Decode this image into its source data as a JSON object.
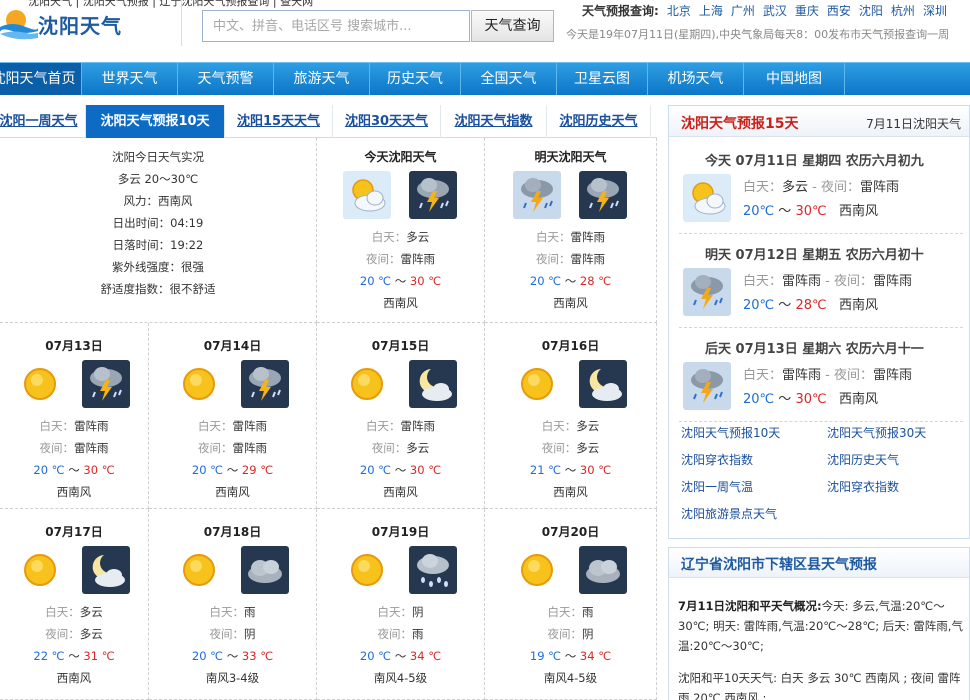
{
  "header": {
    "top_links": "沈阳天气 | 沈阳天气预报 | 辽宁沈阳天气预报查询 | 查天网",
    "logo_text": "沈阳天气",
    "search_placeholder": "中文、拼音、电话区号 搜索城市...",
    "search_button": "天气查询",
    "quick_label": "天气预报查询:",
    "quick_cities": [
      "北京",
      "上海",
      "广州",
      "武汉",
      "重庆",
      "西安",
      "沈阳",
      "杭州",
      "深圳"
    ],
    "publish_info": "今天是19年07月11日(星期四),中央气象局每天8：00发布市天气预报查询一周"
  },
  "nav": [
    "沈阳天气首页",
    "世界天气",
    "天气预警",
    "旅游天气",
    "历史天气",
    "全国天气",
    "卫星云图",
    "机场天气",
    "中国地图"
  ],
  "tabs": [
    "沈阳一周天气",
    "沈阳天气预报10天",
    "沈阳15天天气",
    "沈阳30天天气",
    "沈阳天气指数",
    "沈阳历史天气"
  ],
  "today_info": {
    "title": "沈阳今日天气实况",
    "weather": "多云 20～30℃",
    "wind": "风力：西南风",
    "sunrise": "日出时间：04:19",
    "sunset": "日落时间：19:22",
    "uv": "紫外线强度：很强",
    "comfort": "舒适度指数：很不舒适"
  },
  "labels": {
    "day": "白天：",
    "night": "夜间：",
    "sep": "～"
  },
  "forecast": [
    {
      "title": "今天沈阳天气",
      "day_icon": "partly-cloudy-day-icon",
      "night_icon": "thunder-rain-night-icon",
      "day": "多云",
      "night": "雷阵雨",
      "low": "20 ℃",
      "high": "30 ℃",
      "wind": "西南风"
    },
    {
      "title": "明天沈阳天气",
      "day_icon": "thunder-rain-day-icon",
      "night_icon": "thunder-rain-night-icon",
      "day": "雷阵雨",
      "night": "雷阵雨",
      "low": "20 ℃",
      "high": "28 ℃",
      "wind": "西南风"
    },
    {
      "title": "07月13日",
      "day_icon": "sunny-icon",
      "night_icon": "thunder-rain-night-icon",
      "day": "雷阵雨",
      "night": "雷阵雨",
      "low": "20 ℃",
      "high": "30 ℃",
      "wind": "西南风"
    },
    {
      "title": "07月14日",
      "day_icon": "sunny-icon",
      "night_icon": "thunder-rain-night-icon",
      "day": "雷阵雨",
      "night": "雷阵雨",
      "low": "20 ℃",
      "high": "29 ℃",
      "wind": "西南风"
    },
    {
      "title": "07月15日",
      "day_icon": "sunny-icon",
      "night_icon": "moon-cloud-icon",
      "day": "雷阵雨",
      "night": "多云",
      "low": "20 ℃",
      "high": "30 ℃",
      "wind": "西南风"
    },
    {
      "title": "07月16日",
      "day_icon": "sunny-icon",
      "night_icon": "moon-cloud-icon",
      "day": "多云",
      "night": "多云",
      "low": "21 ℃",
      "high": "30 ℃",
      "wind": "西南风"
    },
    {
      "title": "07月17日",
      "day_icon": "sunny-icon",
      "night_icon": "moon-cloud-icon",
      "day": "多云",
      "night": "多云",
      "low": "22 ℃",
      "high": "31 ℃",
      "wind": "西南风"
    },
    {
      "title": "07月18日",
      "day_icon": "sunny-icon",
      "night_icon": "overcast-icon",
      "day": "雨",
      "night": "阴",
      "low": "20 ℃",
      "high": "33 ℃",
      "wind": "南风3-4级"
    },
    {
      "title": "07月19日",
      "day_icon": "sunny-icon",
      "night_icon": "rain-icon",
      "day": "阴",
      "night": "雨",
      "low": "20 ℃",
      "high": "34 ℃",
      "wind": "南风4-5级"
    },
    {
      "title": "07月20日",
      "day_icon": "sunny-icon",
      "night_icon": "overcast-icon",
      "day": "雨",
      "night": "阴",
      "low": "19 ℃",
      "high": "34 ℃",
      "wind": "南风4-5级"
    }
  ],
  "right_panel": {
    "title": "沈阳天气预报15天",
    "date": "7月11日沈阳天气",
    "days": [
      {
        "header": "今天 07月11日 星期四 农历六月初九",
        "icon": "partly-cloudy-day-icon",
        "day": "多云",
        "night": "雷阵雨",
        "low": "20℃",
        "high": "30℃",
        "wind": "西南风",
        "day_label": "白天：",
        "night_label": "- 夜间：",
        "sep": "～"
      },
      {
        "header": "明天 07月12日 星期五 农历六月初十",
        "icon": "thunder-rain-day-icon",
        "day": "雷阵雨",
        "night": "雷阵雨",
        "low": "20℃",
        "high": "28℃",
        "wind": "西南风",
        "day_label": "白天：",
        "night_label": "- 夜间：",
        "sep": "～"
      },
      {
        "header": "后天 07月13日 星期六 农历六月十一",
        "icon": "thunder-rain-day-icon",
        "day": "雷阵雨",
        "night": "雷阵雨",
        "low": "20℃",
        "high": "30℃",
        "wind": "西南风",
        "day_label": "白天：",
        "night_label": "- 夜间：",
        "sep": "～"
      }
    ],
    "links": [
      "沈阳天气预报10天",
      "沈阳天气预报30天",
      "沈阳穿衣指数",
      "沈阳历史天气",
      "沈阳一周气温",
      "沈阳穿衣指数",
      "沈阳旅游景点天气"
    ]
  },
  "district_panel": {
    "title": "辽宁省沈阳市下辖区县天气预报",
    "p1_bold": "7月11日沈阳和平天气概况:",
    "p1_text": "今天: 多云,气温:20℃～30℃; 明天: 雷阵雨,气温:20℃～28℃; 后天: 雷阵雨,气温:20℃～30℃;",
    "p2_text": "沈阳和平10天天气: 白天 多云 30℃ 西南风 ; 夜间 雷阵雨 20℃ 西南风 ;"
  }
}
